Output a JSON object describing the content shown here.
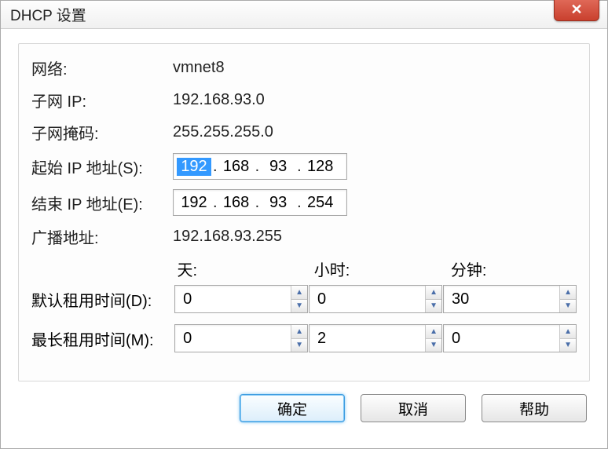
{
  "title": "DHCP 设置",
  "close_icon": "✕",
  "labels": {
    "network": "网络:",
    "subnet_ip": "子网 IP:",
    "subnet_mask": "子网掩码:",
    "start_ip": "起始 IP 地址(S):",
    "end_ip": "结束 IP 地址(E):",
    "broadcast": "广播地址:",
    "days": "天:",
    "hours": "小时:",
    "minutes": "分钟:",
    "default_lease": "默认租用时间(D):",
    "max_lease": "最长租用时间(M):"
  },
  "values": {
    "network": "vmnet8",
    "subnet_ip": "192.168.93.0",
    "subnet_mask": "255.255.255.0",
    "broadcast": "192.168.93.255"
  },
  "start_ip": {
    "o1": "192",
    "o2": "168",
    "o3": "93",
    "o4": "128"
  },
  "end_ip": {
    "o1": "192",
    "o2": "168",
    "o3": "93",
    "o4": "254"
  },
  "default_lease": {
    "days": "0",
    "hours": "0",
    "minutes": "30"
  },
  "max_lease": {
    "days": "0",
    "hours": "2",
    "minutes": "0"
  },
  "buttons": {
    "ok": "确定",
    "cancel": "取消",
    "help": "帮助"
  }
}
